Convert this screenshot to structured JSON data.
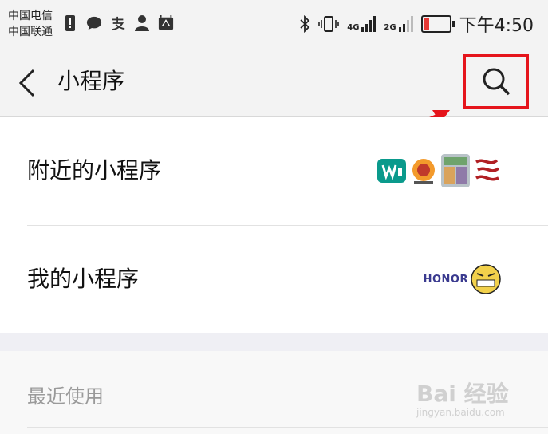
{
  "status_bar": {
    "carrier_1": "中国电信",
    "carrier_2": "中国联通",
    "net_1": "4G",
    "net_2": "2G",
    "time": "下午4:50",
    "battery_level": 0.18,
    "left_icons": [
      "exclamation-icon",
      "chat-icon",
      "alipay-icon",
      "person-icon",
      "huawei-icon"
    ]
  },
  "nav": {
    "title": "小程序",
    "back_icon": "chevron-left-icon",
    "search_icon": "search-icon",
    "highlight_color": "#e5141b"
  },
  "list": {
    "items": [
      {
        "label": "附近的小程序",
        "thumbnails": [
          "watsons-logo",
          "food-logo",
          "store-photo",
          "dragon-logo"
        ]
      },
      {
        "label": "我的小程序",
        "thumbnails": [
          "honor-logo"
        ]
      }
    ]
  },
  "recent": {
    "label": "最近使用"
  },
  "watermark": {
    "main": "Bai 经验",
    "sub": "jingyan.baidu.com"
  },
  "colors": {
    "accent_red": "#e5141b",
    "watsons_teal": "#0a9a8c"
  }
}
